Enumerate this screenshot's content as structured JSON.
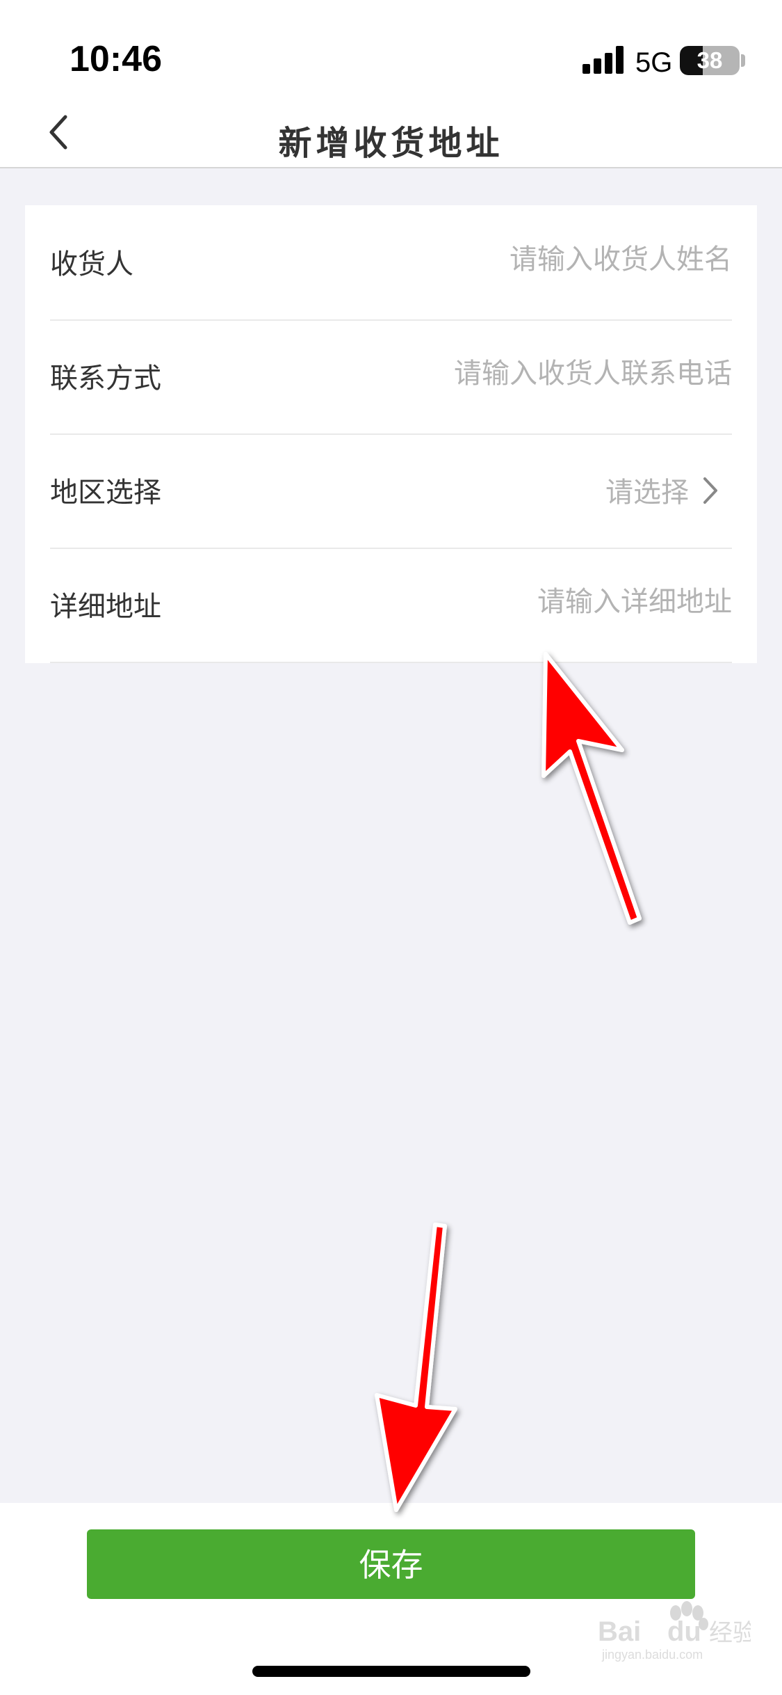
{
  "status_bar": {
    "time": "10:46",
    "network": "5G",
    "battery_level": "38",
    "battery_fraction": 0.38
  },
  "nav": {
    "title": "新增收货地址",
    "back_icon": "chevron-left-icon"
  },
  "form": {
    "fields": [
      {
        "label": "收货人",
        "placeholder": "请输入收货人姓名"
      },
      {
        "label": "联系方式",
        "placeholder": "请输入收货人联系电话"
      },
      {
        "label": "地区选择",
        "placeholder": "请选择",
        "icon": "chevron-right-icon"
      },
      {
        "label": "详细地址",
        "placeholder": "请输入详细地址"
      }
    ]
  },
  "footer": {
    "save_label": "保存",
    "save_color": "#4aab31"
  },
  "annotations": {
    "arrow_color": "#ff0000"
  },
  "watermark": {
    "text": "Baidu经验",
    "subtext": "jingyan.baidu.com"
  }
}
